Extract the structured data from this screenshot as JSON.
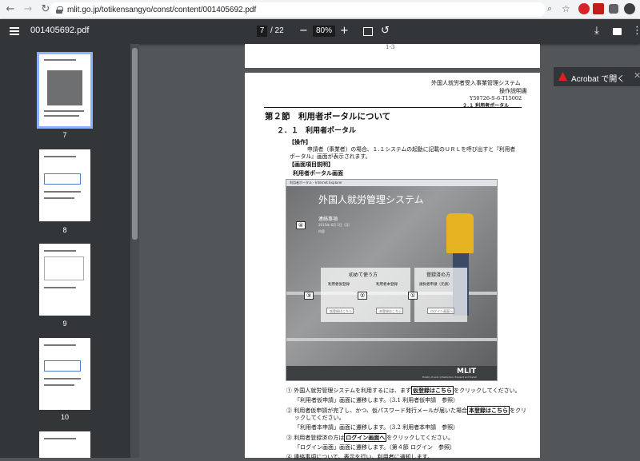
{
  "browser": {
    "url": "mlit.go.jp/totikensangyo/const/content/001405692.pdf"
  },
  "toolbar": {
    "filename": "001405692.pdf",
    "page_current": "7",
    "page_total": "/ 22",
    "zoom": "80%"
  },
  "sidebar": {
    "thumbnails": [
      {
        "label": "7",
        "selected": true
      },
      {
        "label": "8",
        "selected": false
      },
      {
        "label": "9",
        "selected": false
      },
      {
        "label": "10",
        "selected": false
      }
    ]
  },
  "acrobat": {
    "label": "Acrobat で開く"
  },
  "page_top": {
    "footer": "1-3"
  },
  "document": {
    "header1": "外国人就労者受入事業管理システム",
    "header2": "操作説明書",
    "header3": "Y50726-S-6-T15002",
    "header4": "２.１ 利用者ポータル",
    "section_title": "第２節　利用者ポータルについて",
    "subsection_title": "２．１　利用者ポータル",
    "op_label": "【操作】",
    "op_text1": "申請者（事業者）の場合、１.１システムの起動に記載のＵＲＬを呼び出すと『利用者",
    "op_text2": "ポータル』画面が表示されます。",
    "screen_label": "【画面項目説明】",
    "screen_name": "利用者ポータル画面",
    "screenshot": {
      "window_title": "利用者ポータル - Internet Explorer",
      "system_title": "外国人就労管理システム",
      "notice_title": "連絡事項",
      "notice_date": "2015年 6月 1日（月）",
      "notice_body": "内容",
      "first_time": "初めて使う方",
      "registered": "登録済の方",
      "temp_register": "利用者仮登録",
      "full_register": "利用者本登録",
      "contractor_login": "請負者申請（元請）",
      "btn_temp": "仮登録はこちら",
      "btn_full": "本登録はこちら",
      "btn_login": "ログイン画面へ",
      "footer_brand": "MLIT",
      "footer_sub": "Ministry of Land, Infrastructure, Transport and Tourism",
      "tag1": "①",
      "tag2": "②",
      "tag3": "③",
      "tag4": "④"
    },
    "items": [
      {
        "num": "①",
        "text_pre": "外国人就労管理システムを利用するには、まず",
        "btn": "仮登録はこちら",
        "text_post": "をクリックしてください。"
      },
      {
        "sub": "「利用者仮申請」画面に遷移します。（3.1 利用者仮申請　参照）"
      },
      {
        "num": "②",
        "text_pre": "利用者仮申請が完了し、かつ、仮パスワード発行メールが届いた場合",
        "btn": "本登録はこちら",
        "text_post": "をクリ"
      },
      {
        "sub": "ックしてください。"
      },
      {
        "sub": "「利用者本申請」画面に遷移します。（3.2 利用者本申請　参照）"
      },
      {
        "num": "③",
        "text_pre": "利用者登録済の方は",
        "btn": "ログイン画面へ",
        "text_post": "をクリックしてください。"
      },
      {
        "sub": "「ログイン画面」画面に遷移します。（第４節 ログイン　参照）"
      },
      {
        "num": "④",
        "text_pre": "連絡事項について、表示を行い、利用者に通知します。",
        "btn": "",
        "text_post": ""
      }
    ]
  }
}
